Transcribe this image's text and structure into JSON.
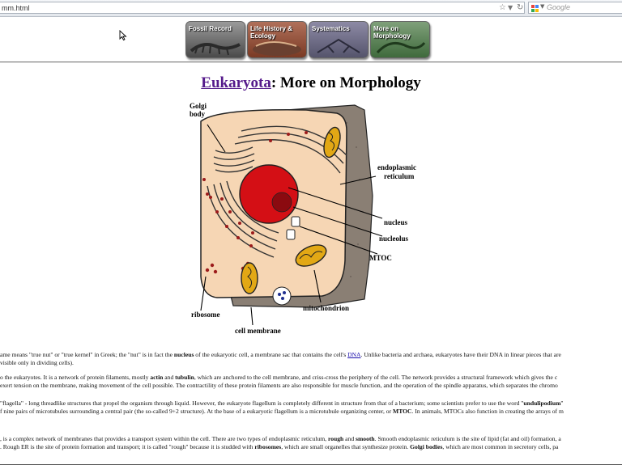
{
  "browser": {
    "url": "mm.html",
    "search_placeholder": "Google"
  },
  "nav": {
    "items": [
      {
        "label": "Fossil Record"
      },
      {
        "label": "Life History & Ecology"
      },
      {
        "label": "Systematics"
      },
      {
        "label": "More on Morphology"
      }
    ]
  },
  "page": {
    "title_link": "Eukaryota",
    "title_rest": ": More on Morphology"
  },
  "diagram": {
    "labels": {
      "golgi": "Golgi body",
      "er": "endoplasmic reticulum",
      "nucleus": "nucleus",
      "nucleolus": "nucleolus",
      "mtoc": "MTOC",
      "mitochondrion": "mitochondrion",
      "ribosome": "ribosome",
      "membrane": "cell membrane"
    }
  },
  "body": {
    "p1_a": "ame means \"true nut\" or \"true kernel\" in Greek; the \"nut\" is in fact the ",
    "p1_b": "nucleus",
    "p1_c": " of the eukaryotic cell, a membrane sac that contains the cell's ",
    "p1_link": "DNA",
    "p1_d": ". Unlike bacteria and archaea, eukaryotes have their DNA in linear pieces that are",
    "p1_line2": " visible only in dividing cells).",
    "p2_a": "o the eukaryotes. It is a network of protein filaments, mostly ",
    "p2_b": "actin",
    "p2_c": " and ",
    "p2_d": "tubulin",
    "p2_e": ", which are anchored to the cell membrane, and criss-cross the periphery of the cell. The network provides a structural framework which gives the c",
    "p2_line2": "exert tension on the membrane, making movement of the cell possible. The contractility of these protein filaments are also responsible for muscle function, and the operation of the spindle apparatus, which separates the chromo",
    "p3_a": "\"flagella\" - long threadlike structures that propel the organism through liquid. However, the eukaryote flagellum is completely different in structure from that of a bacterium; some scientists prefer to use the word \"",
    "p3_b": "undulipodium",
    "p3_c": "\"",
    "p3_line2a": "f nine pairs of microtubules surrounding a central pair (the so-called 9+2 structure). At the base of a eukaryotic flagellum is a microtubule organizing center, or ",
    "p3_line2b": "MTOC",
    "p3_line2c": ". In animals, MTOCs also function in creating the arrays of m",
    "p4_a": ", is a complex network of membranes that provides a transport system within the cell. There are two types of endoplasmic reticulum, ",
    "p4_b": "rough",
    "p4_c": " and ",
    "p4_d": "smooth",
    "p4_e": ". Smooth endoplasmic reticulum is the site of lipid (fat and oil) formation, a",
    "p4_line2a": ". Rough ER is the site of protein formation and transport; it is called \"rough\" because it is studded with ",
    "p4_line2b": "ribosomes",
    "p4_line2c": ", which are small organelles that synthesize protein. ",
    "p4_line2d": "Golgi bodies",
    "p4_line2e": ", which are most common in secretory cells, pa"
  }
}
